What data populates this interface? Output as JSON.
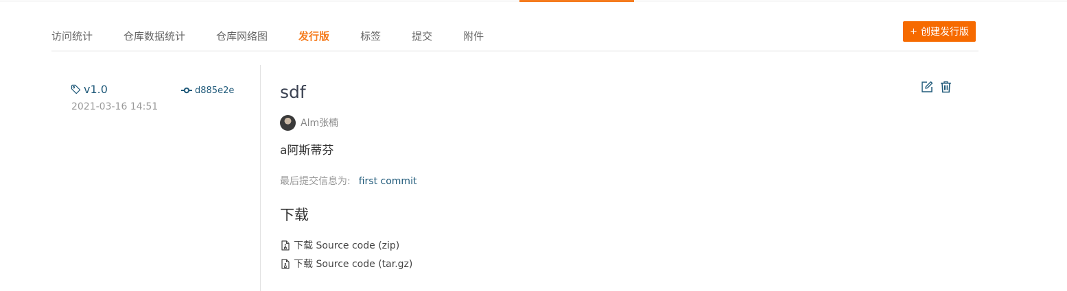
{
  "tabs": [
    {
      "label": "访问统计",
      "active": false
    },
    {
      "label": "仓库数据统计",
      "active": false
    },
    {
      "label": "仓库网络图",
      "active": false
    },
    {
      "label": "发行版",
      "active": true
    },
    {
      "label": "标签",
      "active": false
    },
    {
      "label": "提交",
      "active": false
    },
    {
      "label": "附件",
      "active": false
    }
  ],
  "create_button": {
    "plus": "+",
    "label": "创建发行版"
  },
  "release": {
    "tag": "v1.0",
    "date": "2021-03-16 14:51",
    "commit_sha": "d885e2e",
    "title": "sdf",
    "author": "Alm张楠",
    "description": "a阿斯蒂芬",
    "last_commit_label": "最后提交信息为:",
    "last_commit_message": "first commit",
    "downloads_heading": "下载",
    "downloads": [
      {
        "label": "下载 Source code (zip)"
      },
      {
        "label": "下载 Source code (tar.gz)"
      }
    ]
  },
  "icons": {
    "tag": "tag-icon",
    "commit": "commit-icon",
    "edit": "edit-icon",
    "delete": "trash-icon",
    "file": "file-archive-icon"
  },
  "colors": {
    "accent": "#f57c1f",
    "button": "#f66a00",
    "link": "#205a7a"
  }
}
